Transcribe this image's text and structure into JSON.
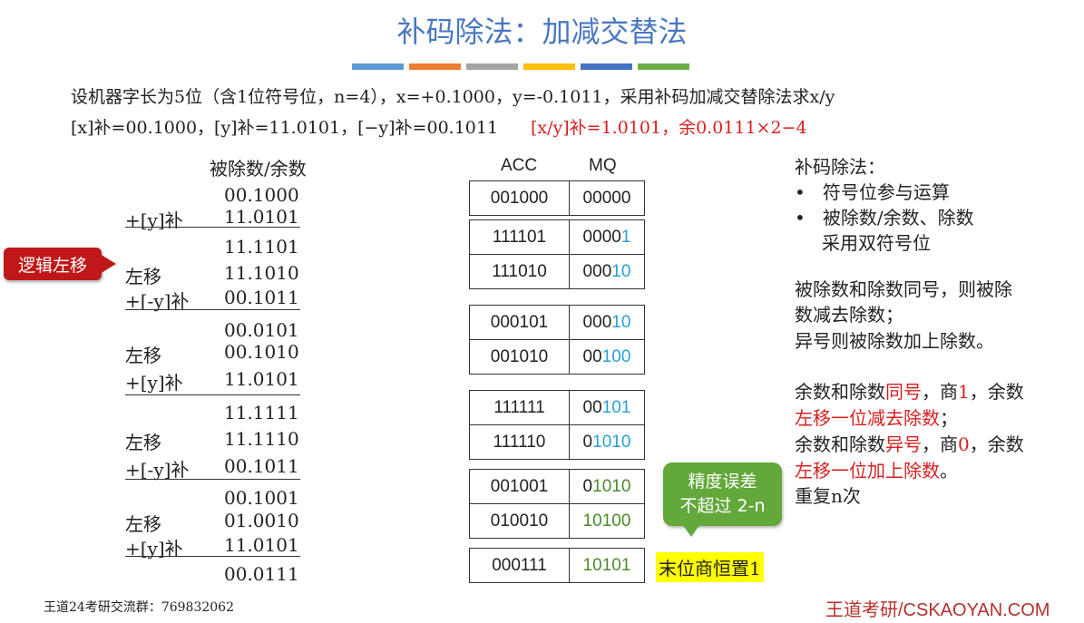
{
  "title": "补码除法：加减交替法",
  "colors": {
    "title": "#4a78c2",
    "red": "#d62020",
    "green": "#62a83a",
    "blue_digit": "#2aa0d4",
    "dark_red": "#b2312c",
    "highlight": "#ffff00"
  },
  "color_bars": [
    "#5b9bd5",
    "#ed7d31",
    "#a5a5a5",
    "#ffc000",
    "#4472c4",
    "#70ad47"
  ],
  "problem": "设机器字长为5位（含1位符号位，n=4），x=+0.1000，y=-0.1011，采用补码加减交替除法求x/y",
  "given": "[x]补=00.1000，[y]补=11.0101，[−y]补=00.1011",
  "answer": "[x/y]补=1.0101，余0.0111×2−4",
  "left": {
    "header": "被除数/余数",
    "rows": [
      {
        "num": "00.1000"
      },
      {
        "op": "+[y]补",
        "num": "11.0101"
      },
      {
        "num": "11.1101"
      },
      {
        "op": "左移",
        "num": "11.1010"
      },
      {
        "op": "+[-y]补",
        "num": "00.1011"
      },
      {
        "num": "00.0101"
      },
      {
        "op": "左移",
        "num": "00.1010"
      },
      {
        "op": "+[y]补",
        "num": "11.0101"
      },
      {
        "num": "11.1111"
      },
      {
        "op": "左移",
        "num": "11.1110"
      },
      {
        "op": "+[-y]补",
        "num": "00.1011"
      },
      {
        "num": "00.1001"
      },
      {
        "op": "左移",
        "num": "01.0010"
      },
      {
        "op": "+[y]补",
        "num": "11.0101"
      },
      {
        "num": "00.0111"
      }
    ]
  },
  "callout_shift": "逻辑左移",
  "registers": {
    "acc_label": "ACC",
    "mq_label": "MQ",
    "groups": [
      [
        {
          "acc": "001000",
          "mq": "00000"
        }
      ],
      [
        {
          "acc": "111101",
          "mq": "00001"
        },
        {
          "acc": "111010",
          "mq": "00010"
        }
      ],
      [
        {
          "acc": "000101",
          "mq": "00010"
        },
        {
          "acc": "001010",
          "mq": "00100"
        }
      ],
      [
        {
          "acc": "111111",
          "mq": "00101"
        },
        {
          "acc": "111110",
          "mq": "01010"
        }
      ],
      [
        {
          "acc": "001001",
          "mq": "01010"
        },
        {
          "acc": "010010",
          "mq": "10100"
        }
      ],
      [
        {
          "acc": "000111",
          "mq": "10101"
        }
      ]
    ]
  },
  "bubble_precision": [
    "精度误差",
    "不超过 2-n"
  ],
  "last_bit_note": "末位商恒置1",
  "right_panel": {
    "heading": "补码除法：",
    "bullets": [
      "符号位参与运算",
      "被除数/余数、除数",
      "采用双符号位"
    ],
    "para1": [
      "被除数和除数同号，则被除",
      "数减去除数；",
      "异号则被除数加上除数。"
    ],
    "para2_l1": [
      "余数和除数",
      "同号",
      "，商",
      "1",
      "，余数"
    ],
    "para2_l2": "左移一位减去除数",
    "para2_l2_end": "；",
    "para2_l3": [
      "余数和除数",
      "异号",
      "，商",
      "0",
      "，余数"
    ],
    "para2_l4": "左移一位加上除数",
    "para2_l4_end": "。",
    "para2_l5": "重复n次"
  },
  "footer_left": "王道24考研交流群：769832062",
  "footer_right": "王道考研/CSKAOYAN.COM"
}
